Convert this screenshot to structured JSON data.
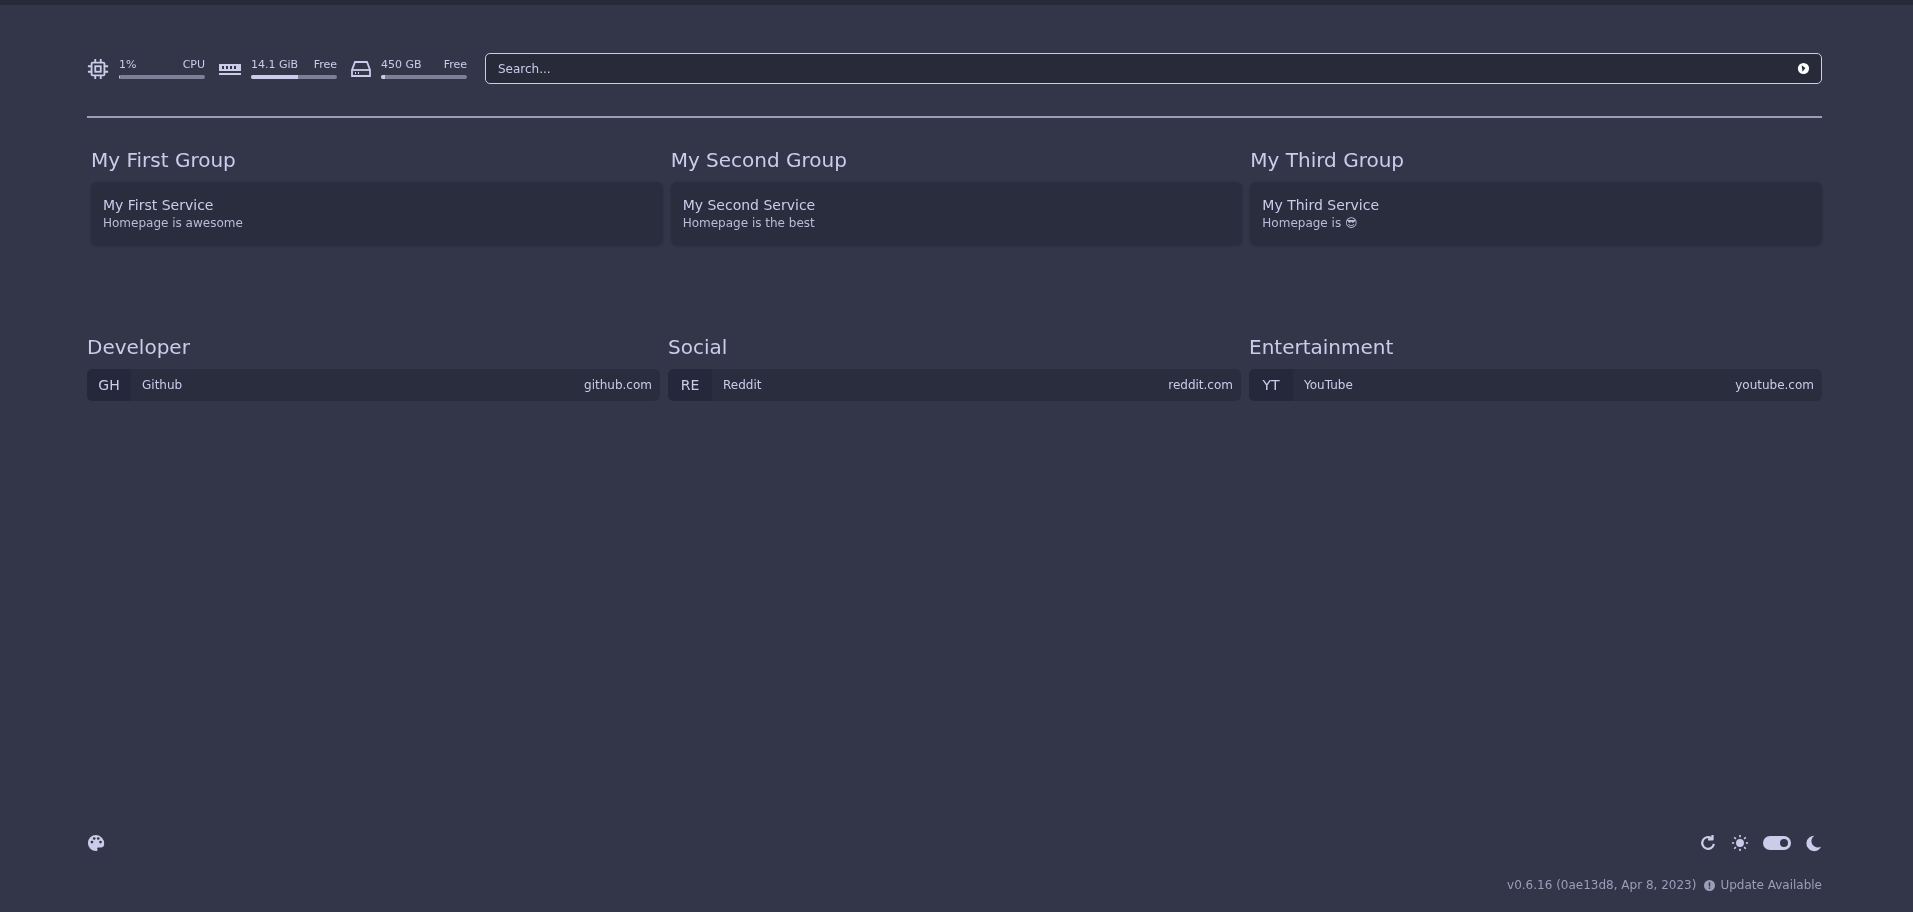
{
  "resources": [
    {
      "kind": "cpu",
      "value": "1%",
      "label": "CPU",
      "level": 0.01
    },
    {
      "kind": "memory",
      "value": "14.1 GiB",
      "label": "Free",
      "level": 0.55
    },
    {
      "kind": "disk",
      "value": "450 GB",
      "label": "Free",
      "level": 0.05
    }
  ],
  "search": {
    "placeholder": "Search..."
  },
  "service_groups": [
    {
      "title": "My First Group",
      "services": [
        {
          "name": "My First Service",
          "description": "Homepage is awesome"
        }
      ]
    },
    {
      "title": "My Second Group",
      "services": [
        {
          "name": "My Second Service",
          "description": "Homepage is the best"
        }
      ]
    },
    {
      "title": "My Third Group",
      "services": [
        {
          "name": "My Third Service",
          "description": "Homepage is 😎"
        }
      ]
    }
  ],
  "bookmark_groups": [
    {
      "title": "Developer",
      "bookmarks": [
        {
          "abbr": "GH",
          "name": "Github",
          "url": "github.com"
        }
      ]
    },
    {
      "title": "Social",
      "bookmarks": [
        {
          "abbr": "RE",
          "name": "Reddit",
          "url": "reddit.com"
        }
      ]
    },
    {
      "title": "Entertainment",
      "bookmarks": [
        {
          "abbr": "YT",
          "name": "YouTube",
          "url": "youtube.com"
        }
      ]
    }
  ],
  "footer": {
    "dark_mode": true,
    "version": "v0.6.16 (0ae13d8, Apr 8, 2023)",
    "update": "Update Available"
  }
}
